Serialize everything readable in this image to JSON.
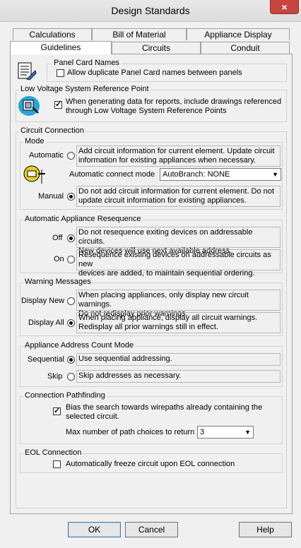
{
  "window": {
    "title": "Design Standards",
    "close_glyph": "×"
  },
  "tabs": {
    "row1": [
      "Calculations",
      "Bill of Material",
      "Appliance Display"
    ],
    "row2": [
      "Guidelines",
      "Circuits",
      "Conduit"
    ],
    "active": "Guidelines"
  },
  "panel_card": {
    "legend": "Panel Card Names",
    "allow_dup_label": "Allow duplicate Panel Card names between panels",
    "allow_dup_checked": false
  },
  "lvsrp": {
    "legend": "Low Voltage System Reference Point",
    "label_line1": "When generating data for reports, include drawings referenced",
    "label_line2": "through Low Voltage System Reference Points",
    "checked": true
  },
  "circuit_connection": {
    "legend": "Circuit Connection",
    "mode": {
      "legend": "Mode",
      "automatic_label": "Automatic",
      "automatic_desc_l1": "Add circuit information for current element. Update circuit",
      "automatic_desc_l2": "information for existing appliances when necessary.",
      "auto_connect_label": "Automatic connect mode",
      "auto_connect_value": "AutoBranch: NONE",
      "manual_label": "Manual",
      "manual_desc_l1": "Do not add circuit information for current element.  Do not",
      "manual_desc_l2": "update circuit information for existing appliances.",
      "selected": "Manual"
    },
    "resequence": {
      "legend": "Automatic Appliance Resequence",
      "off_label": "Off",
      "off_desc_l1": "Do not resequence exiting devices on addressable circuits.",
      "off_desc_l2": "New devices will use next available address.",
      "on_label": "On",
      "on_desc_l1": "Resequence existing devices on addressable circuits as new",
      "on_desc_l2": "devices are added, to maintain sequential ordering.",
      "selected": "Off"
    },
    "warnings": {
      "legend": "Warning Messages",
      "new_label": "Display New",
      "new_desc_l1": "When placing appliances, only display new circuit warnings.",
      "new_desc_l2": "Do not redisplay prior warnings.",
      "all_label": "Display All",
      "all_desc_l1": "When placing appliance, display all circuit warnings.",
      "all_desc_l2": "Redisplay all prior warnings still in effect.",
      "selected": "Display All"
    },
    "address_count": {
      "legend": "Appliance Address Count Mode",
      "seq_label": "Sequential",
      "seq_desc": "Use sequential addressing.",
      "skip_label": "Skip",
      "skip_desc": "Skip addresses as necessary.",
      "selected": "Sequential"
    },
    "pathfinding": {
      "legend": "Connection Pathfinding",
      "bias_l1": "Bias the search towards wirepaths already containing the",
      "bias_l2": "selected circuit.",
      "bias_checked": true,
      "max_label": "Max number of path choices to return",
      "max_value": "3"
    },
    "eol": {
      "legend": "EOL Connection",
      "freeze_label": "Automatically freeze circuit upon EOL connection",
      "freeze_checked": false
    }
  },
  "buttons": {
    "ok": "OK",
    "cancel": "Cancel",
    "help": "Help"
  },
  "icons": {
    "panel_card": "panel-card-icon",
    "lvsrp": "low-voltage-reference-icon",
    "mode": "circuit-connect-icon",
    "dropdown": "chevron-down-icon"
  },
  "colors": {
    "close_button": "#c7453e",
    "dialog_bg": "#f0f0f0"
  }
}
